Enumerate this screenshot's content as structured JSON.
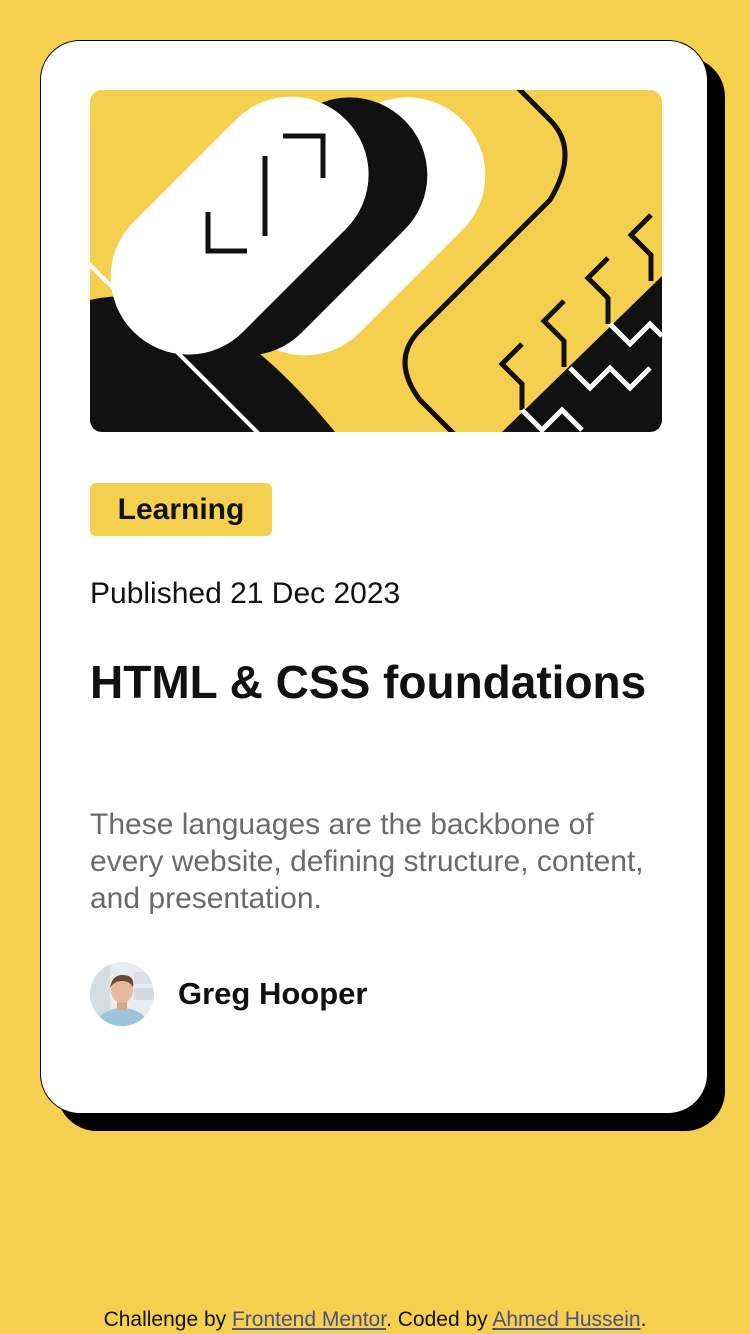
{
  "card": {
    "category_tag": "Learning",
    "published_label": "Published 21 Dec 2023",
    "title": "HTML & CSS foundations",
    "description": "These languages are the backbone of every website, defining structure, content, and presentation.",
    "author": {
      "name": "Greg Hooper"
    }
  },
  "footer": {
    "prefix": "Challenge by ",
    "link1_text": "Frontend Mentor",
    "middle": ". Coded by ",
    "link2_text": "Ahmed Hussein",
    "suffix": "."
  },
  "colors": {
    "background": "#F4D04E",
    "card": "#FFFFFF",
    "shadow": "#000000",
    "text_primary": "#111111",
    "text_secondary": "#6B6B6B",
    "link": "#4C4F86"
  },
  "icons": {
    "illustration": "abstract-code-illustration",
    "avatar": "author-avatar-photo"
  }
}
